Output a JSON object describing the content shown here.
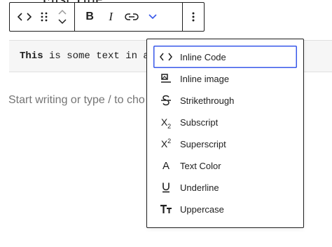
{
  "heading_fragment": "First Title",
  "toolbar": {
    "block_type_icon": "code-icon",
    "drag_icon": "drag-handle-icon",
    "move_up_icon": "chevron-up-icon",
    "move_down_icon": "chevron-down-icon",
    "bold_label": "B",
    "italic_label": "I",
    "link_icon": "link-icon",
    "more_rich_text_icon": "chevron-down-icon",
    "options_icon": "more-vertical-icon",
    "accent_color": "#3858e9"
  },
  "block": {
    "code_bold_word": "This",
    "code_rest": " is some text in a"
  },
  "placeholder": "Start writing or type / to cho",
  "dropdown": {
    "items": [
      {
        "icon": "code-icon",
        "label": "Inline Code",
        "focused": true
      },
      {
        "icon": "inline-image-icon",
        "label": "Inline image"
      },
      {
        "icon": "strikethrough-icon",
        "label": "Strikethrough"
      },
      {
        "icon": "subscript-icon",
        "label": "Subscript",
        "glyph": "X",
        "small": "2"
      },
      {
        "icon": "superscript-icon",
        "label": "Superscript",
        "glyph": "X",
        "small": "2"
      },
      {
        "icon": "text-color-icon",
        "label": "Text Color",
        "glyph": "A"
      },
      {
        "icon": "underline-icon",
        "label": "Underline"
      },
      {
        "icon": "uppercase-icon",
        "label": "Uppercase"
      }
    ]
  }
}
